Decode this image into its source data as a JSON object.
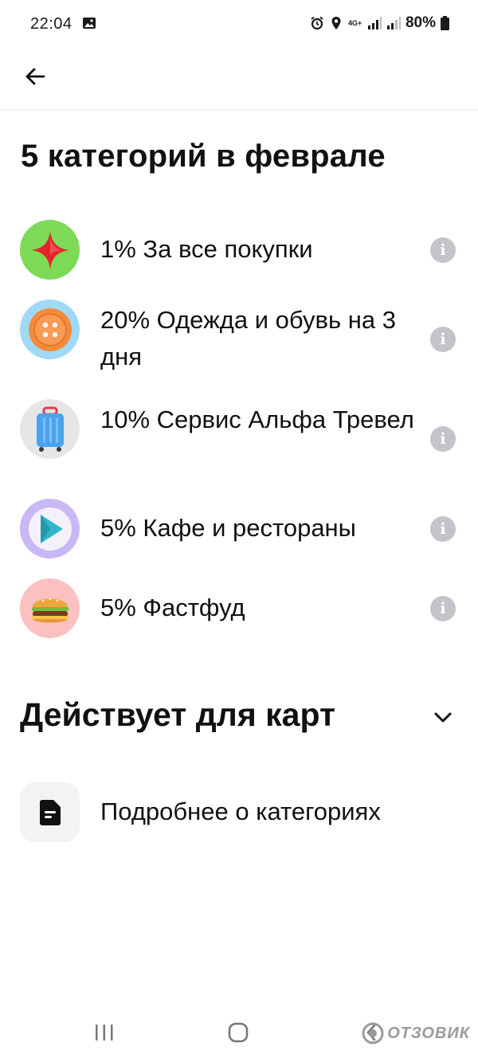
{
  "status_bar": {
    "time": "22:04",
    "network_label": "4G+",
    "battery": "80%"
  },
  "app_bar": {
    "back_icon": "arrow-left-icon"
  },
  "page": {
    "title": "5 категорий в феврале"
  },
  "categories": [
    {
      "label": "1% За все покупки",
      "icon": "red-star-icon",
      "bg": "#7ed957"
    },
    {
      "label": "20% Одежда и обувь на 3 дня",
      "icon": "button-icon",
      "bg": "#9fd9f5"
    },
    {
      "label": "10% Сервис Альфа Тревел",
      "icon": "suitcase-icon",
      "bg": "#e6e6e6"
    },
    {
      "label": "5% Кафе и рестораны",
      "icon": "play-icon",
      "bg": "#c8b8f5"
    },
    {
      "label": "5% Фастфуд",
      "icon": "burger-icon",
      "bg": "#fbc1c1"
    }
  ],
  "info_icon_glyph": "i",
  "cards_section": {
    "title": "Действует для карт"
  },
  "more": {
    "label": "Подробнее о категориях"
  },
  "watermark": {
    "text": "ОТЗОВИК"
  },
  "colors": {
    "text": "#111111",
    "info": "#c2c4c9",
    "divider": "#e8e8ea"
  }
}
